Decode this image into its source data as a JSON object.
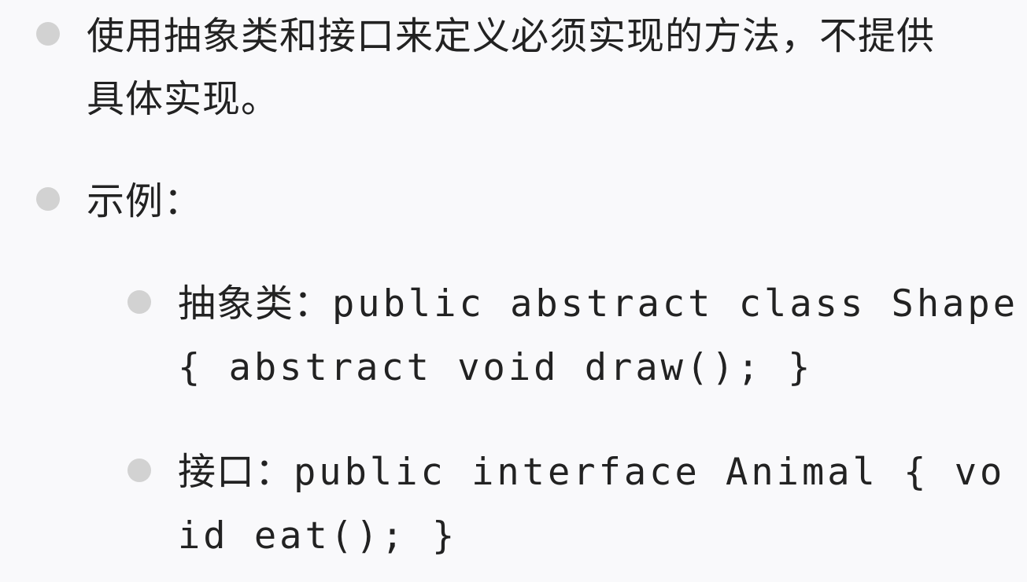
{
  "items": [
    {
      "line1": "使用抽象类和接口来定义必须实现的方法，不提供",
      "line2": "具体实现。"
    },
    {
      "line1": "示例："
    }
  ],
  "subitems": [
    {
      "label": "抽象类：",
      "code_line1": "public abstract class Shape",
      "code_line2": "{ abstract void draw(); }"
    },
    {
      "label": "接口：",
      "code_line1": "public interface Animal { vo",
      "code_line2": "id eat(); }"
    }
  ]
}
